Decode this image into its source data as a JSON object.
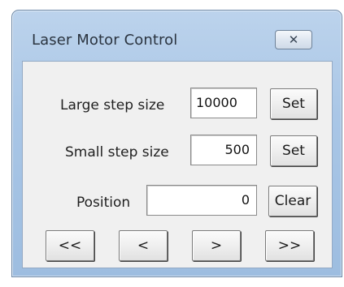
{
  "window": {
    "title": "Laser Motor Control",
    "close_icon": "close-icon"
  },
  "rows": {
    "large_step": {
      "label": "Large step size",
      "value": "10000",
      "button": "Set"
    },
    "small_step": {
      "label": "Small step size",
      "value": "500",
      "button": "Set"
    },
    "position": {
      "label": "Position",
      "value": "0",
      "button": "Clear"
    }
  },
  "nav": {
    "fast_back": "<<",
    "back": "<",
    "forward": ">",
    "fast_forward": ">>"
  }
}
